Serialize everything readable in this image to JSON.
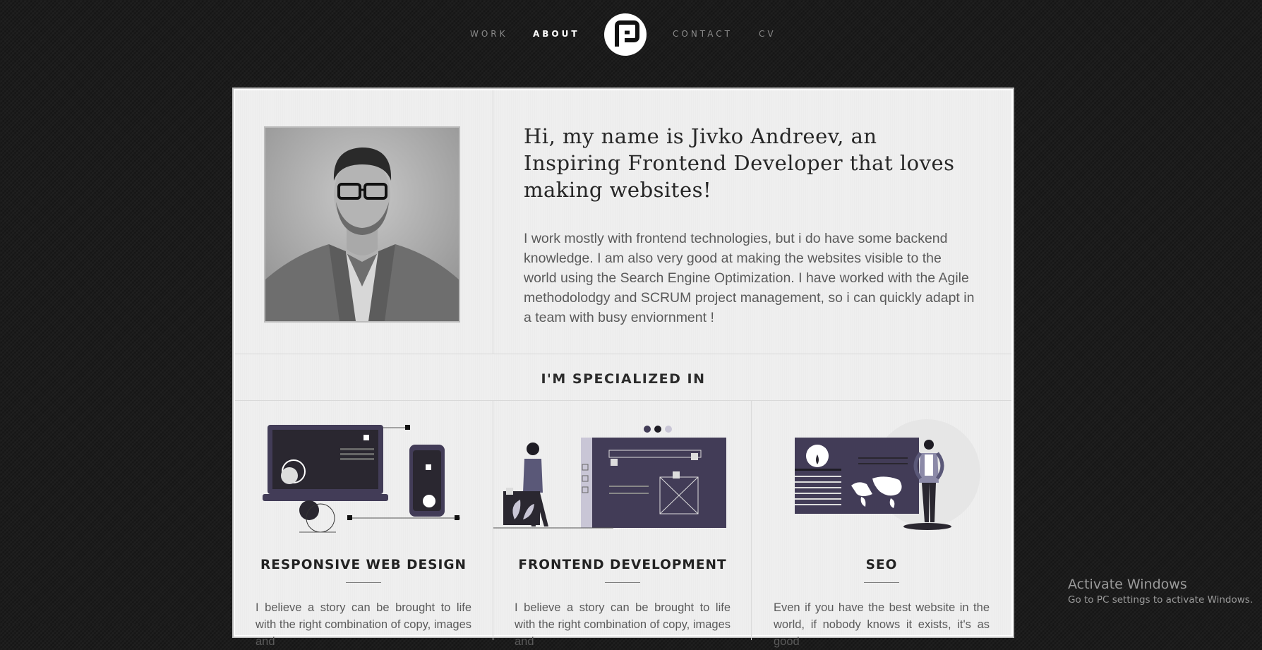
{
  "nav": {
    "links": [
      {
        "label": "WORK"
      },
      {
        "label": "ABOUT",
        "active": true
      },
      {
        "label": "CONTACT"
      },
      {
        "label": "CV"
      }
    ]
  },
  "intro": {
    "title": "Hi, my name is Jivko Andreev, an Inspiring Frontend Developer that loves making websites!",
    "text": "I work mostly with frontend technologies, but i do have some backend knowledge. I am also very good at making the websites visible to the world using the Search Engine Optimization. I have worked with the Agile methodolodgy and SCRUM project management, so i can quickly adapt in a team with busy enviornment !"
  },
  "specialized": {
    "heading": "I'M SPECIALIZED IN",
    "items": [
      {
        "title": "RESPONSIVE WEB DESIGN",
        "text": "I believe a story can be brought to life with the right combination of copy, images and",
        "icon": "responsive-devices-illustration"
      },
      {
        "title": "FRONTEND DEVELOPMENT",
        "text": "I believe a story can be brought to life with the right combination of copy, images and",
        "icon": "frontend-dashboard-illustration"
      },
      {
        "title": "SEO",
        "text": "Even if you have the best website in the world, if nobody knows it exists, it's as good",
        "icon": "seo-world-map-illustration"
      }
    ]
  },
  "watermark": {
    "title": "Activate Windows",
    "subtitle": "Go to PC settings to activate Windows."
  },
  "colors": {
    "accent": "#423c57",
    "background": "#1c1c1c",
    "card": "#efefef"
  }
}
